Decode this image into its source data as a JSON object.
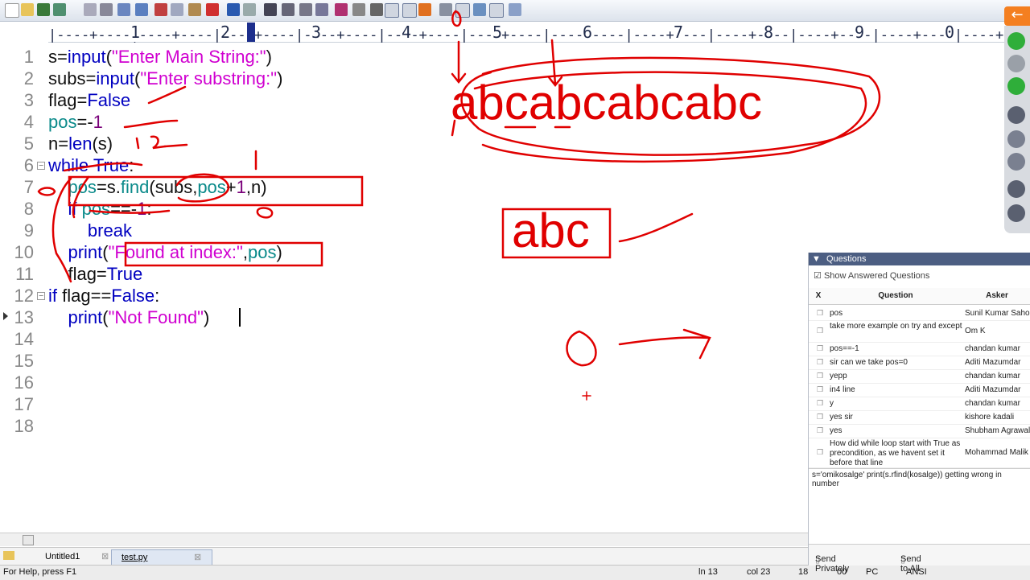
{
  "ruler": {
    "numbers": [
      "1",
      "2",
      "3",
      "4",
      "5",
      "6",
      "7",
      "8",
      "9",
      "0"
    ]
  },
  "code": {
    "line_numbers": [
      "1",
      "2",
      "3",
      "4",
      "5",
      "6",
      "7",
      "8",
      "9",
      "10",
      "11",
      "12",
      "13",
      "14",
      "15",
      "16",
      "17",
      "18"
    ],
    "lines": [
      [
        {
          "t": "s=",
          "c": "d"
        },
        {
          "t": "input",
          "c": "k"
        },
        {
          "t": "(",
          "c": "d"
        },
        {
          "t": "\"Enter Main String:\"",
          "c": "s"
        },
        {
          "t": ")",
          "c": "d"
        }
      ],
      [
        {
          "t": "subs=",
          "c": "d"
        },
        {
          "t": "input",
          "c": "k"
        },
        {
          "t": "(",
          "c": "d"
        },
        {
          "t": "\"Enter substring:\"",
          "c": "s"
        },
        {
          "t": ")",
          "c": "d"
        }
      ],
      [
        {
          "t": "flag=",
          "c": "d"
        },
        {
          "t": "False",
          "c": "k"
        }
      ],
      [
        {
          "t": "pos",
          "c": "b"
        },
        {
          "t": "=-",
          "c": "d"
        },
        {
          "t": "1",
          "c": "n"
        }
      ],
      [
        {
          "t": "n=",
          "c": "d"
        },
        {
          "t": "len",
          "c": "k"
        },
        {
          "t": "(s)",
          "c": "d"
        }
      ],
      [
        {
          "t": "while ",
          "c": "k"
        },
        {
          "t": "True",
          "c": "k"
        },
        {
          "t": ":",
          "c": "d"
        }
      ],
      [
        {
          "t": "    "
        },
        {
          "t": "pos",
          "c": "b"
        },
        {
          "t": "=s.",
          "c": "d"
        },
        {
          "t": "find",
          "c": "b"
        },
        {
          "t": "(subs,",
          "c": "d"
        },
        {
          "t": "pos",
          "c": "b"
        },
        {
          "t": "+",
          "c": "d"
        },
        {
          "t": "1",
          "c": "n"
        },
        {
          "t": ",n)",
          "c": "d"
        }
      ],
      [
        {
          "t": "    "
        },
        {
          "t": "if ",
          "c": "k"
        },
        {
          "t": "pos",
          "c": "b"
        },
        {
          "t": "==-",
          "c": "d"
        },
        {
          "t": "1",
          "c": "n"
        },
        {
          "t": ":",
          "c": "d"
        }
      ],
      [
        {
          "t": "        "
        },
        {
          "t": "break",
          "c": "k"
        }
      ],
      [
        {
          "t": "    "
        },
        {
          "t": "print",
          "c": "k"
        },
        {
          "t": "(",
          "c": "d"
        },
        {
          "t": "\"Found at index:\"",
          "c": "s"
        },
        {
          "t": ",",
          "c": "d"
        },
        {
          "t": "pos",
          "c": "b"
        },
        {
          "t": ")",
          "c": "d"
        }
      ],
      [
        {
          "t": "    "
        },
        {
          "t": "flag=",
          "c": "d"
        },
        {
          "t": "True",
          "c": "k"
        }
      ],
      [
        {
          "t": "if ",
          "c": "k"
        },
        {
          "t": "flag==",
          "c": "d"
        },
        {
          "t": "False",
          "c": "k"
        },
        {
          "t": ":",
          "c": "d"
        }
      ],
      [
        {
          "t": "    "
        },
        {
          "t": "print",
          "c": "k"
        },
        {
          "t": "(",
          "c": "d"
        },
        {
          "t": "\"Not Found\"",
          "c": "s"
        },
        {
          "t": ")",
          "c": "d"
        }
      ]
    ]
  },
  "annotations": {
    "big_string": "abcabcabcabc",
    "small_string": "abc"
  },
  "tabs": {
    "tab1": "Untitled1",
    "tab2": "test.py"
  },
  "status": {
    "help": "For Help, press F1",
    "line": "ln 13",
    "col": "col 23",
    "f1": "18",
    "f2": "00",
    "f3": "PC",
    "enc": "ANSI"
  },
  "questions": {
    "title": "Questions",
    "show_answered": "Show Answered Questions",
    "col_x": "X",
    "col_question": "Question",
    "col_asker": "Asker",
    "rows": [
      {
        "q": "pos",
        "a": "Sunil Kumar Sahoo"
      },
      {
        "q": "take more example on try and except",
        "a": "Om K"
      },
      {
        "q": "pos==-1",
        "a": "chandan kumar"
      },
      {
        "q": "sir can we take pos=0",
        "a": "Aditi Mazumdar"
      },
      {
        "q": "yepp",
        "a": "chandan kumar"
      },
      {
        "q": "in4 line",
        "a": "Aditi Mazumdar"
      },
      {
        "q": "y",
        "a": "chandan kumar"
      },
      {
        "q": "yes sir",
        "a": "kishore kadali"
      },
      {
        "q": "yes",
        "a": "Shubham Agrawal"
      },
      {
        "q": "How did while loop start with True as precondition, as we havent set it before that line",
        "a": "Mohammad Malik"
      }
    ],
    "selected_text": "s='omikosalge'      print(s.rfind(kosalge)) getting wrong in number",
    "send_private": "Send Privately",
    "send_all": "Send to All"
  },
  "colors": {
    "ink": "#e00000",
    "keyword": "#0000c0",
    "string": "#d000d0",
    "builtin": "#0a8a8a",
    "header": "#4c5e82",
    "orange": "#f47f20"
  }
}
